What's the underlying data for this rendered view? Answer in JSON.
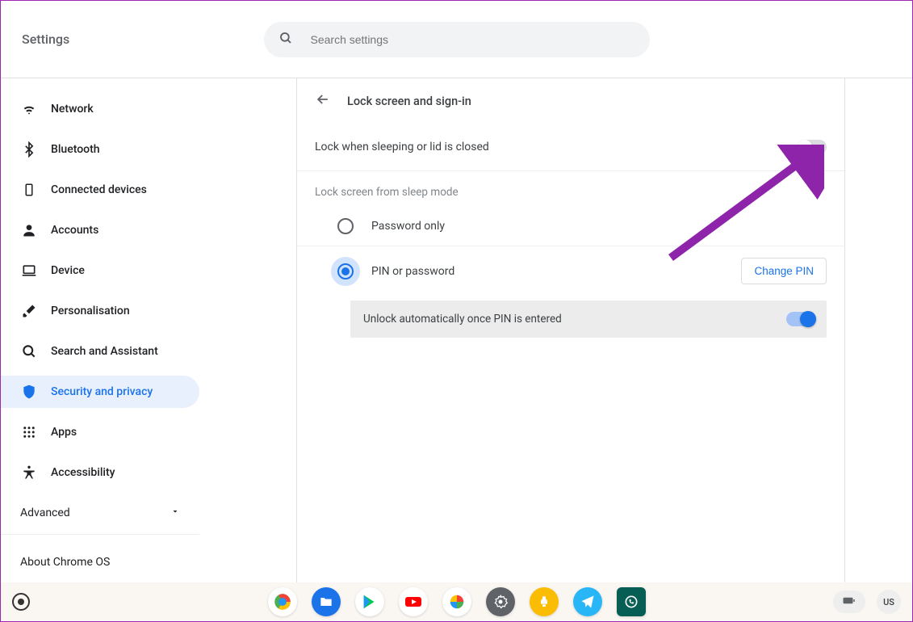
{
  "header": {
    "title": "Settings",
    "search_placeholder": "Search settings"
  },
  "sidebar": {
    "items": [
      {
        "icon": "wifi",
        "label": "Network"
      },
      {
        "icon": "bt",
        "label": "Bluetooth"
      },
      {
        "icon": "phone",
        "label": "Connected devices"
      },
      {
        "icon": "person",
        "label": "Accounts"
      },
      {
        "icon": "laptop",
        "label": "Device"
      },
      {
        "icon": "brush",
        "label": "Personalisation"
      },
      {
        "icon": "search",
        "label": "Search and Assistant"
      },
      {
        "icon": "shield",
        "label": "Security and privacy"
      },
      {
        "icon": "apps",
        "label": "Apps"
      },
      {
        "icon": "a11y",
        "label": "Accessibility"
      }
    ],
    "active_index": 7,
    "advanced_label": "Advanced",
    "about_label": "About Chrome OS"
  },
  "main": {
    "back_aria": "Back",
    "title": "Lock screen and sign-in",
    "lock_lid_label": "Lock when sleeping or lid is closed",
    "lock_lid_state": "off",
    "section_label": "Lock screen from sleep mode",
    "option_password": "Password only",
    "option_pin": "PIN or password",
    "selected_option": "pin",
    "change_pin_label": "Change PIN",
    "unlock_auto_label": "Unlock automatically once PIN is entered",
    "unlock_auto_state": "on"
  },
  "shelf": {
    "apps": [
      "chrome",
      "files",
      "play",
      "youtube",
      "photos",
      "settings",
      "keep",
      "telegram",
      "whatsapp"
    ],
    "ime_label": "US"
  },
  "colors": {
    "accent": "#1a73e8",
    "arrow": "#8e24aa"
  }
}
